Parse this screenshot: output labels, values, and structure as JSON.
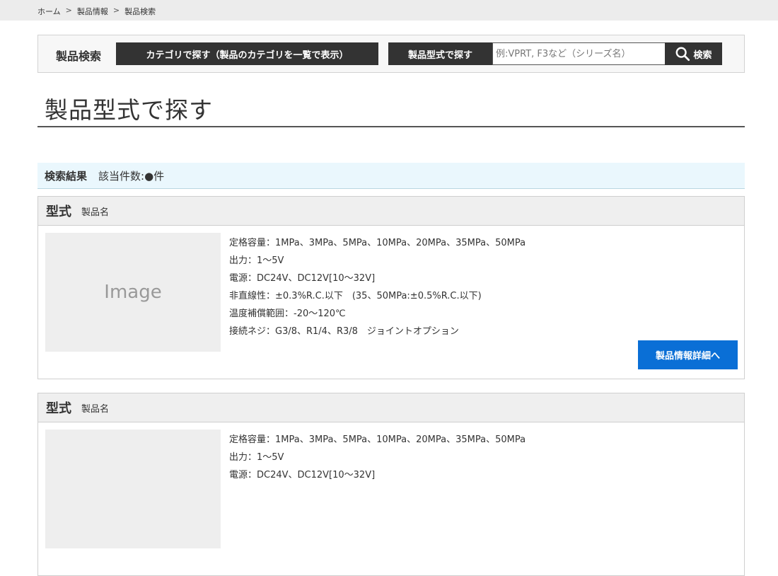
{
  "breadcrumb": [
    "ホーム",
    "製品情報",
    "製品検索"
  ],
  "search": {
    "label": "製品検索",
    "category_button": "カテゴリで探す（製品のカテゴリを一覧で表示）",
    "model_label": "製品型式で探す",
    "model_placeholder": "例:VPRT, F3など（シリーズ名）",
    "model_value": "",
    "search_button": "検索"
  },
  "page_title": "製品型式で探す",
  "results": {
    "title": "検索結果",
    "count_text": "該当件数:●件"
  },
  "products": [
    {
      "model": "型式",
      "name": "製品名",
      "image_label": "Image",
      "specs": [
        "定格容量：1MPa、3MPa、5MPa、10MPa、20MPa、35MPa、50MPa",
        "出力：1〜5V",
        "電源：DC24V、DC12V[10〜32V]",
        "非直線性：±0.3%R.C.以下　(35、50MPa:±0.5%R.C.以下)",
        "温度補償範囲：-20〜120℃",
        "接続ネジ：G3/8、R1/4、R3/8　ジョイントオプション"
      ],
      "detail_button": "製品情報詳細へ"
    },
    {
      "model": "型式",
      "name": "製品名",
      "image_label": "",
      "specs": [
        "定格容量：1MPa、3MPa、5MPa、10MPa、20MPa、35MPa、50MPa",
        "出力：1〜5V",
        "電源：DC24V、DC12V[10〜32V]"
      ],
      "detail_button": ""
    }
  ]
}
